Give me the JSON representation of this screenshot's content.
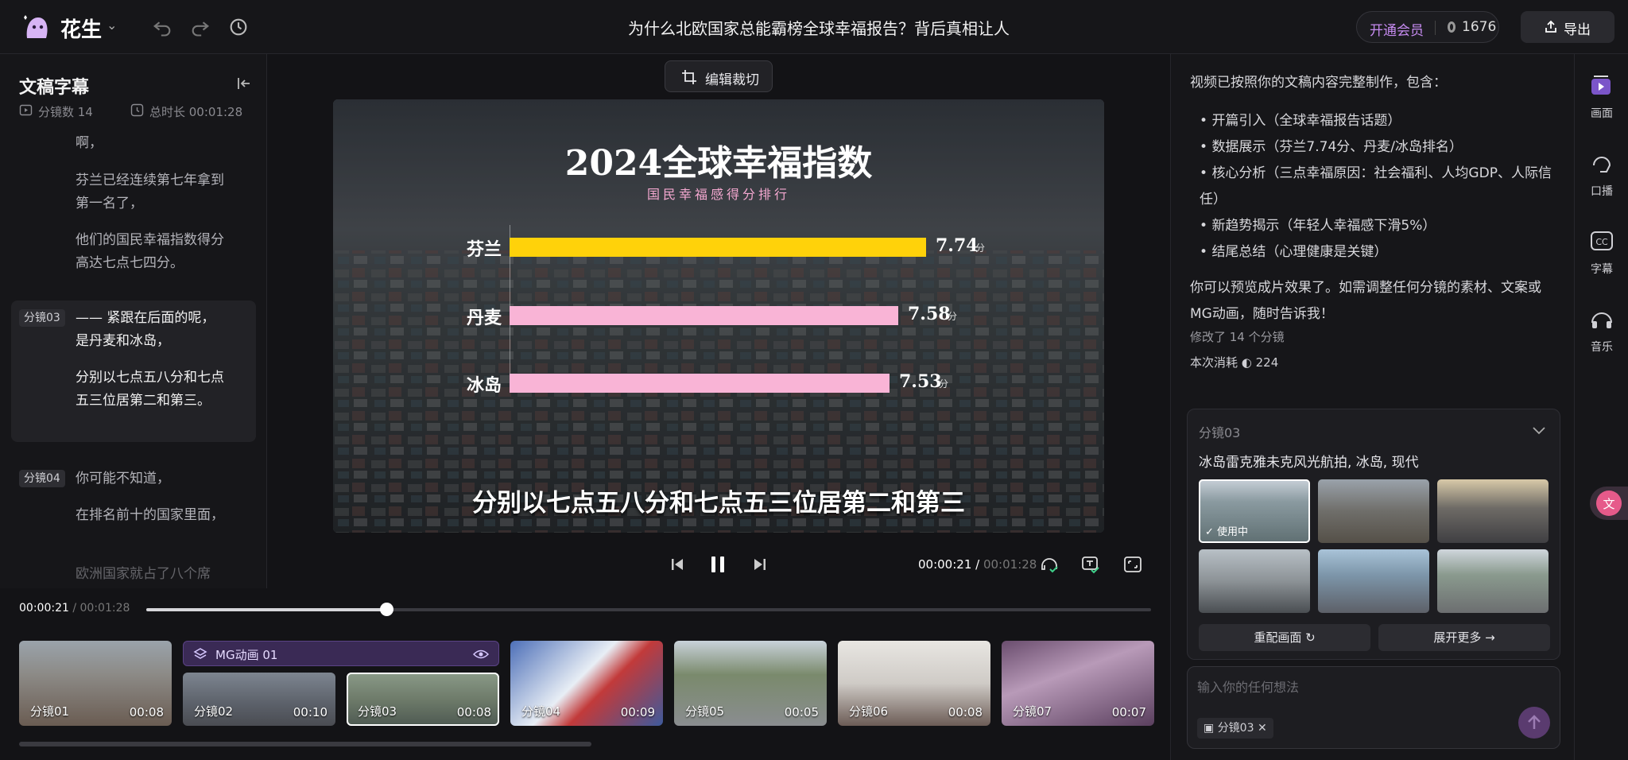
{
  "app": {
    "name": "花生",
    "document_title": "为什么北欧国家总能霸榜全球幸福报告？背后真相让人"
  },
  "header": {
    "member_label": "开通会员",
    "credits": "1676",
    "export_label": "导出"
  },
  "left_panel": {
    "title": "文稿字幕",
    "scene_count": "分镜数 14",
    "total_duration": "总时长 00:01:28",
    "lines": [
      {
        "text": "啊，",
        "tag": ""
      },
      {
        "text": "芬兰已经连续第七年拿到第一名了，",
        "tag": ""
      },
      {
        "text": "他们的国民幸福指数得分高达七点七四分。",
        "tag": ""
      },
      {
        "text": "—— 紧跟在后面的呢，是丹麦和冰岛，",
        "tag": "分镜03"
      },
      {
        "text": "分别以七点五八分和七点五三位居第二和第三。",
        "tag": ""
      },
      {
        "text": "你可能不知道，",
        "tag": "分镜04"
      },
      {
        "text": "在排名前十的国家里面，",
        "tag": ""
      },
      {
        "text": "欧洲国家就占了八个席",
        "tag": ""
      }
    ]
  },
  "center": {
    "crop_label": "编辑裁切",
    "time_current": "00:00:21",
    "time_total": "00:01:28",
    "playback_fraction": 0.239,
    "caption": "分别以七点五八分和七点五三位居第二和第三"
  },
  "chart_data": {
    "type": "bar",
    "title": "2024全球幸福指数",
    "subtitle": "国民幸福感得分排行",
    "categories": [
      "芬兰",
      "丹麦",
      "冰岛"
    ],
    "values": [
      7.74,
      7.58,
      7.53
    ],
    "value_labels": [
      "7.74",
      "7.58",
      "7.53"
    ],
    "unit": "分",
    "colors": [
      "#ffd20a",
      "#f9b4d6",
      "#f9b4d6"
    ]
  },
  "timeline": {
    "time_current": "00:00:21",
    "time_total": "00:01:28",
    "mg_label": "MG动画 01",
    "clips": [
      {
        "name": "分镜01",
        "dur": "00:08"
      },
      {
        "name": "分镜02",
        "dur": "00:10"
      },
      {
        "name": "分镜03",
        "dur": "00:08"
      },
      {
        "name": "分镜04",
        "dur": "00:09"
      },
      {
        "name": "分镜05",
        "dur": "00:05"
      },
      {
        "name": "分镜06",
        "dur": "00:08"
      },
      {
        "name": "分镜07",
        "dur": "00:07"
      }
    ]
  },
  "right_panel": {
    "intro": "视频已按照你的文稿内容完整制作，包含：",
    "bullets": [
      "开篇引入（全球幸福报告话题）",
      "数据展示（芬兰7.74分、丹麦/冰岛排名）",
      "核心分析（三点幸福原因：社会福利、人均GDP、人际信任）",
      "新趋势揭示（年轻人幸福感下滑5%）",
      "结尾总结（心理健康是关键）"
    ],
    "outro": "你可以预览成片效果了。如需调整任何分镜的素材、文案或MG动画，随时告诉我！",
    "modified": "修改了 14 个分镜",
    "cost_label": "本次消耗",
    "cost_value": "224",
    "card": {
      "tag": "分镜03",
      "desc": "冰岛雷克雅未克风光航拍, 冰岛, 现代",
      "using_label": "使用中",
      "regen_label": "重配画面",
      "more_label": "展开更多"
    },
    "chat": {
      "placeholder": "输入你的任何想法",
      "chip": "分镜03"
    }
  },
  "rail": {
    "items": [
      "画面",
      "口播",
      "字幕",
      "音乐"
    ]
  }
}
